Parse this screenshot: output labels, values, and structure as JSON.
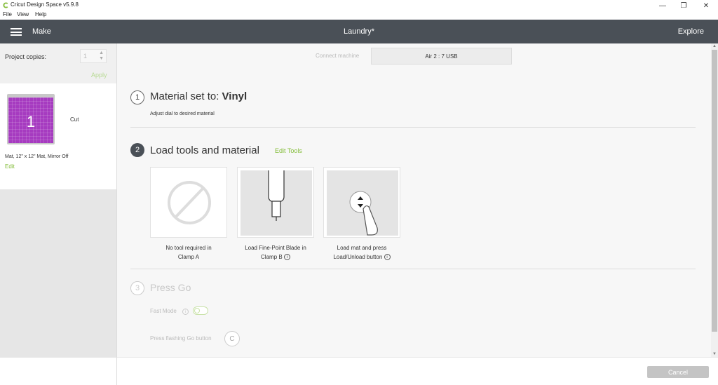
{
  "window": {
    "title": "Cricut Design Space  v5.9.8",
    "controls": {
      "minimize": "—",
      "maximize": "❐",
      "close": "✕"
    }
  },
  "menu": {
    "items": [
      "File",
      "View",
      "Help"
    ]
  },
  "header": {
    "left_label": "Make",
    "title": "Laundry*",
    "right_label": "Explore"
  },
  "sidebar": {
    "copies_label": "Project copies:",
    "copies_value": "1",
    "apply_label": "Apply",
    "mat": {
      "number": "1",
      "action": "Cut",
      "description": "Mat, 12\" x 12\" Mat, Mirror Off",
      "edit_label": "Edit",
      "color": "#a63bc0"
    }
  },
  "connect": {
    "label": "Connect machine",
    "machine": "Air 2 : 7 USB"
  },
  "steps": {
    "step1": {
      "number": "1",
      "title_prefix": "Material set to: ",
      "material": "Vinyl",
      "subtitle": "Adjust dial to desired material"
    },
    "step2": {
      "number": "2",
      "title": "Load tools and material",
      "edit_tools_label": "Edit Tools",
      "cards": [
        {
          "line1": "No tool required in",
          "line2": "Clamp A"
        },
        {
          "line1": "Load Fine-Point Blade in",
          "line2": "Clamp B"
        },
        {
          "line1": "Load mat and press",
          "line2": "Load/Unload button"
        }
      ]
    },
    "step3": {
      "number": "3",
      "title": "Press Go",
      "fast_mode_label": "Fast Mode",
      "press_go_label": "Press flashing Go button"
    }
  },
  "footer": {
    "cancel_label": "Cancel"
  },
  "colors": {
    "accent_green": "#84bd3a",
    "header_bg": "#4a5057"
  }
}
